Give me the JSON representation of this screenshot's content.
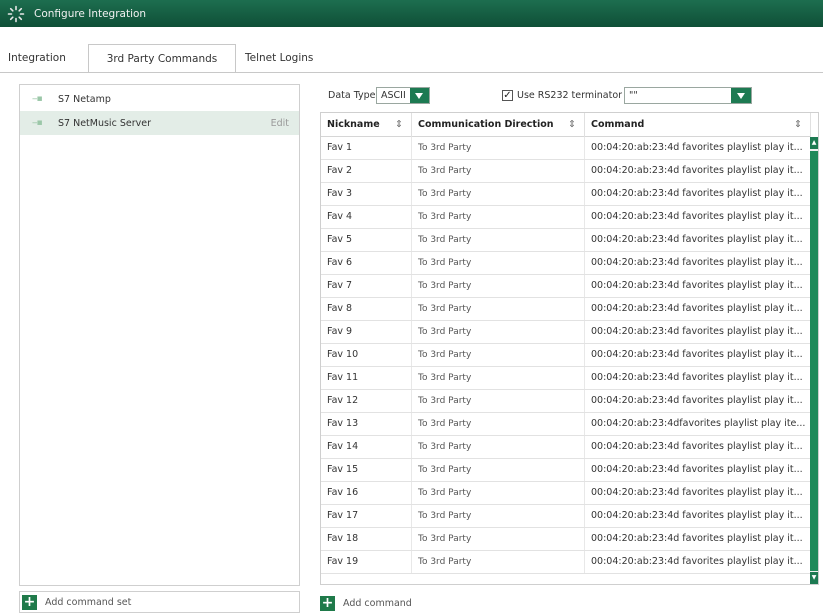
{
  "window": {
    "title": "Configure Integration"
  },
  "tabs": [
    {
      "label": "Integration"
    },
    {
      "label": "3rd Party Commands"
    },
    {
      "label": "Telnet Logins"
    }
  ],
  "command_sets": [
    {
      "name": "S7 Netamp",
      "edit": ""
    },
    {
      "name": "S7 NetMusic Server",
      "edit": "Edit"
    }
  ],
  "add_command_set_label": "Add command set",
  "controls": {
    "data_type_label": "Data Type",
    "data_type_value": "ASCII",
    "terminator_label": "Use RS232 terminator",
    "terminator_checked": "✓",
    "terminator_value": "\"\""
  },
  "table": {
    "columns": [
      "Nickname",
      "Communication Direction",
      "Command"
    ],
    "sort_glyph": "⇕",
    "rows": [
      {
        "nickname": "Fav 1",
        "direction": "To 3rd Party",
        "command": "00:04:20:ab:23:4d favorites playlist play it..."
      },
      {
        "nickname": "Fav 2",
        "direction": "To 3rd Party",
        "command": "00:04:20:ab:23:4d favorites playlist play it..."
      },
      {
        "nickname": "Fav 3",
        "direction": "To 3rd Party",
        "command": "00:04:20:ab:23:4d favorites playlist play it..."
      },
      {
        "nickname": "Fav 4",
        "direction": "To 3rd Party",
        "command": "00:04:20:ab:23:4d favorites playlist play it..."
      },
      {
        "nickname": "Fav 5",
        "direction": "To 3rd Party",
        "command": "00:04:20:ab:23:4d favorites playlist play it..."
      },
      {
        "nickname": "Fav 6",
        "direction": "To 3rd Party",
        "command": "00:04:20:ab:23:4d favorites playlist play it..."
      },
      {
        "nickname": "Fav 7",
        "direction": "To 3rd Party",
        "command": "00:04:20:ab:23:4d favorites playlist play it..."
      },
      {
        "nickname": "Fav 8",
        "direction": "To 3rd Party",
        "command": "00:04:20:ab:23:4d favorites playlist play it..."
      },
      {
        "nickname": "Fav 9",
        "direction": "To 3rd Party",
        "command": "00:04:20:ab:23:4d favorites playlist play it..."
      },
      {
        "nickname": "Fav 10",
        "direction": "To 3rd Party",
        "command": "00:04:20:ab:23:4d favorites playlist play it..."
      },
      {
        "nickname": "Fav 11",
        "direction": "To 3rd Party",
        "command": "00:04:20:ab:23:4d favorites playlist play it..."
      },
      {
        "nickname": "Fav 12",
        "direction": "To 3rd Party",
        "command": "00:04:20:ab:23:4d favorites playlist play it..."
      },
      {
        "nickname": "Fav 13",
        "direction": "To 3rd Party",
        "command": "00:04:20:ab:23:4dfavorites playlist play ite..."
      },
      {
        "nickname": "Fav 14",
        "direction": "To 3rd Party",
        "command": "00:04:20:ab:23:4d favorites playlist play it..."
      },
      {
        "nickname": "Fav 15",
        "direction": "To 3rd Party",
        "command": "00:04:20:ab:23:4d favorites playlist play it..."
      },
      {
        "nickname": "Fav 16",
        "direction": "To 3rd Party",
        "command": "00:04:20:ab:23:4d favorites playlist play it..."
      },
      {
        "nickname": "Fav 17",
        "direction": "To 3rd Party",
        "command": "00:04:20:ab:23:4d favorites playlist play it..."
      },
      {
        "nickname": "Fav 18",
        "direction": "To 3rd Party",
        "command": "00:04:20:ab:23:4d favorites playlist play it..."
      },
      {
        "nickname": "Fav 19",
        "direction": "To 3rd Party",
        "command": "00:04:20:ab:23:4d favorites playlist play it..."
      }
    ]
  },
  "add_command_label": "Add command",
  "colors": {
    "accent": "#1d7a52",
    "titlebar": "#0f4f37",
    "selected_row": "#e3ede7"
  }
}
